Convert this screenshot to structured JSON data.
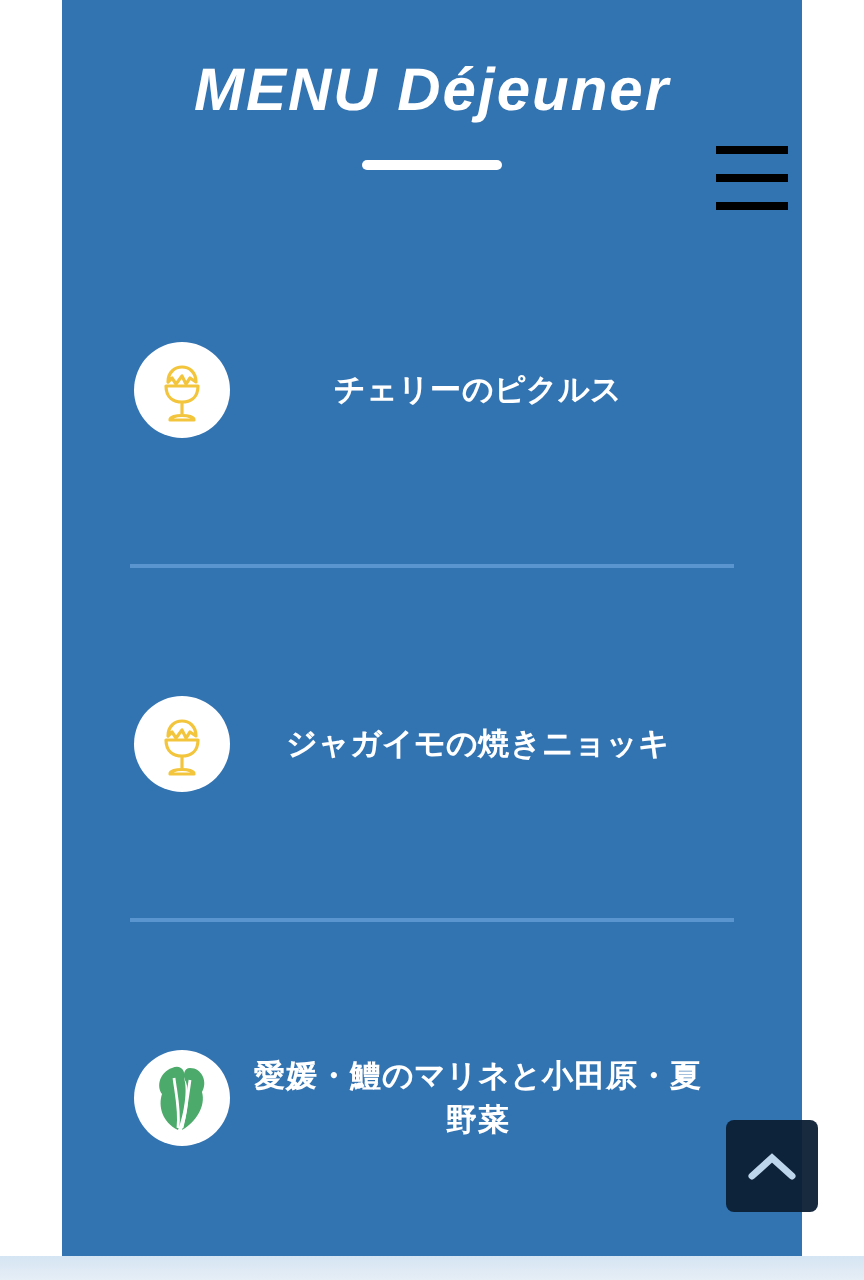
{
  "title": "MENU Déjeuner",
  "items": [
    {
      "kind": "egg",
      "name": "チェリーのピクルス"
    },
    {
      "kind": "egg",
      "name": "ジャガイモの焼きニョッキ"
    },
    {
      "kind": "leaf",
      "name": "愛媛・鱧のマリネと小田原・夏野菜"
    }
  ]
}
